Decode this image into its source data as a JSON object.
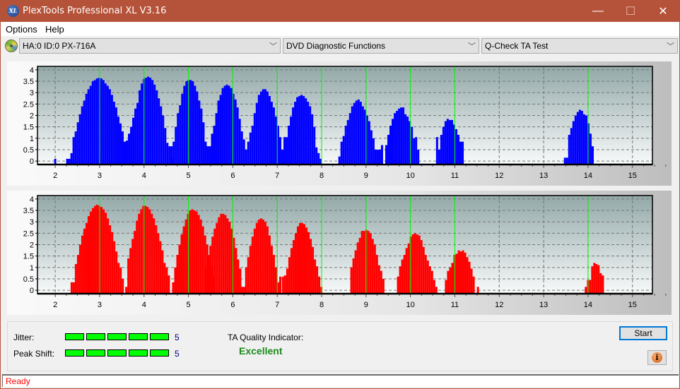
{
  "window": {
    "title": "PlexTools Professional XL V3.16",
    "app_icon_text": "XL",
    "minimize_glyph": "—",
    "maximize_glyph": "☐",
    "close_glyph": "✕"
  },
  "menu": [
    "Options",
    "Help"
  ],
  "toolbar": {
    "drive": "HA:0 ID:0  PX-716A",
    "function_group": "DVD Diagnostic Functions",
    "test": "Q-Check TA Test",
    "chevron": "﹀"
  },
  "colors": {
    "accent_title": "#b5533a",
    "top_bars": "#0000ff",
    "bottom_bars": "#ff0000",
    "marker_lines": "#00ff00",
    "quality_text": "#1a8a1a",
    "status_text": "#ff0000"
  },
  "chart_data": [
    {
      "type": "bar",
      "name": "top-chart",
      "title": "",
      "xlabel": "",
      "ylabel": "",
      "xlim": [
        1.6,
        15.45
      ],
      "ylim": [
        -0.15,
        4.15
      ],
      "xticks": [
        2,
        3,
        4,
        5,
        6,
        7,
        8,
        9,
        10,
        11,
        12,
        13,
        14,
        15
      ],
      "yticks": [
        0,
        0.5,
        1,
        1.5,
        2,
        2.5,
        3,
        3.5,
        4
      ],
      "ytick_labels": [
        "0",
        "0.5",
        "1",
        "1.5",
        "2",
        "2.5",
        "3",
        "3.5",
        "4"
      ],
      "grid": true,
      "reference_lines_x": [
        3,
        4,
        5,
        6,
        7,
        8,
        9,
        10,
        11,
        14
      ],
      "bar_step": 0.048,
      "clusters": [
        {
          "start": 2.0,
          "values": [
            0.1
          ]
        },
        {
          "start": 2.27,
          "values": [
            0.1,
            0.1,
            0.35,
            1.05,
            1.3,
            1.7,
            2.05,
            2.4,
            2.65,
            2.95,
            3.15,
            3.3,
            3.5,
            3.55,
            3.62,
            3.65,
            3.62,
            3.55,
            3.4,
            3.3,
            3.15,
            2.9,
            2.6,
            2.35,
            1.95,
            1.65,
            1.3,
            0.85,
            0.9,
            1.2,
            1.5,
            1.9,
            2.3,
            2.55,
            3.1,
            3.4,
            3.6,
            3.65,
            3.7,
            3.65,
            3.55,
            3.35,
            3.1,
            2.75,
            2.4,
            2.0,
            1.45,
            0.8,
            0.65,
            0.1
          ]
        },
        {
          "start": 4.62,
          "values": [
            0.65,
            0.85,
            1.5,
            2.1,
            2.45,
            2.95,
            3.3,
            3.5,
            3.55,
            3.55,
            3.5,
            3.3,
            3.05,
            2.65,
            2.3,
            1.7,
            0.85,
            0.65,
            0.65,
            1.2,
            1.55,
            2.1,
            2.65,
            2.9,
            3.2,
            3.3,
            3.35,
            3.3,
            3.2,
            2.95,
            2.7,
            2.35,
            1.85,
            1.3,
            0.95,
            0.5,
            0.85,
            1.25,
            1.55,
            2.1,
            2.55,
            2.9,
            3.05,
            3.15,
            3.15,
            3.05,
            2.85,
            2.6,
            2.35,
            1.95,
            1.55,
            1.05,
            0.5,
            1.05,
            1.05,
            1.55,
            1.95,
            2.35,
            2.6,
            2.8,
            2.85,
            2.9,
            2.85,
            2.75,
            2.6,
            2.4,
            2.05,
            1.5,
            0.6,
            0.35,
            0.1
          ]
        },
        {
          "start": 8.4,
          "values": [
            0.2,
            0.85,
            1.1,
            1.55,
            1.8,
            2.1,
            2.4,
            2.55,
            2.65,
            2.7,
            2.6,
            2.4,
            2.25,
            2.0,
            1.75,
            1.35,
            1.0,
            0.5,
            0.5,
            0.5,
            0.7,
            0.0,
            0.7,
            1.15,
            1.55,
            1.85,
            2.1,
            2.2,
            2.3,
            2.35,
            2.35,
            2.05,
            1.95,
            1.75,
            1.5,
            1.0,
            1.05,
            0.5
          ]
        },
        {
          "start": 10.6,
          "values": [
            1.05,
            0.5,
            1.15,
            1.5,
            1.75,
            1.85,
            1.8,
            1.8,
            1.6,
            1.4,
            1.15,
            0.85,
            0.85
          ]
        },
        {
          "start": 13.48,
          "values": [
            0.15,
            0.15,
            1.15,
            1.45,
            1.75,
            2.0,
            2.15,
            2.25,
            2.2,
            2.05,
            2.0,
            1.65,
            1.2,
            0.65
          ]
        }
      ]
    },
    {
      "type": "bar",
      "name": "bottom-chart",
      "title": "",
      "xlabel": "",
      "ylabel": "",
      "xlim": [
        1.6,
        15.45
      ],
      "ylim": [
        -0.15,
        4.15
      ],
      "xticks": [
        2,
        3,
        4,
        5,
        6,
        7,
        8,
        9,
        10,
        11,
        12,
        13,
        14,
        15
      ],
      "yticks": [
        0,
        0.5,
        1,
        1.5,
        2,
        2.5,
        3,
        3.5,
        4
      ],
      "ytick_labels": [
        "0",
        "0.5",
        "1",
        "1.5",
        "2",
        "2.5",
        "3",
        "3.5",
        "4"
      ],
      "grid": true,
      "reference_lines_x": [
        3,
        4,
        5,
        6,
        7,
        8,
        9,
        10,
        11,
        14
      ],
      "bar_step": 0.048,
      "clusters": [
        {
          "start": 2.37,
          "values": [
            0.35,
            0.35,
            1.15,
            1.55,
            2.0,
            2.4,
            2.7,
            2.95,
            3.25,
            3.45,
            3.6,
            3.7,
            3.75,
            3.7,
            3.65,
            3.55,
            3.4,
            3.15,
            2.85,
            2.55,
            2.15,
            1.7,
            1.2,
            1.0,
            0.5
          ]
        },
        {
          "start": 3.6,
          "values": [
            0.15,
            1.4,
            1.85,
            2.25,
            2.6,
            3.05,
            3.35,
            3.55,
            3.7,
            3.7,
            3.65,
            3.55,
            3.35,
            3.15,
            2.85,
            2.5,
            2.15,
            1.75,
            1.2,
            1.0,
            0.65,
            0.0,
            0.35,
            1.0,
            1.55,
            2.0,
            2.45,
            2.8,
            3.1,
            3.35,
            3.5,
            3.55,
            3.5,
            3.45,
            3.3,
            3.1,
            2.8,
            2.4,
            2.0,
            1.45,
            1.05,
            0.6
          ]
        },
        {
          "start": 5.4,
          "values": [
            1.0,
            1.55,
            1.95,
            2.35,
            2.7,
            2.95,
            3.2,
            3.35,
            3.35,
            3.3,
            3.15,
            3.0,
            2.7,
            2.3,
            1.85,
            1.35,
            0.95,
            0.15,
            0.15
          ]
        },
        {
          "start": 6.3,
          "values": [
            1.0,
            1.45,
            1.95,
            2.35,
            2.7,
            2.95,
            3.1,
            3.15,
            3.1,
            3.0,
            2.8,
            2.4,
            1.95,
            1.55,
            1.0,
            0.35,
            0.6
          ]
        },
        {
          "start": 7.13,
          "values": [
            0.6,
            0.65,
            0.95,
            1.45,
            1.85,
            2.2,
            2.5,
            2.8,
            2.95,
            2.95,
            2.9,
            2.75,
            2.55,
            2.25,
            1.9,
            1.35,
            1.05,
            0.6,
            0.15
          ]
        },
        {
          "start": 8.67,
          "values": [
            1.0,
            1.4,
            1.75,
            2.1,
            2.3,
            2.6,
            2.6,
            2.65,
            2.6,
            2.5,
            2.25,
            2.0,
            1.55,
            1.1,
            0.85,
            0.5
          ]
        },
        {
          "start": 9.72,
          "values": [
            0.6,
            1.05,
            1.35,
            1.55,
            1.85,
            2.05,
            2.35,
            2.45,
            2.5,
            2.45,
            2.4,
            2.2,
            1.9,
            1.55,
            1.3,
            1.05,
            0.85,
            0.45,
            0.15
          ]
        },
        {
          "start": 10.8,
          "values": [
            0.45,
            0.85,
            1.0,
            1.2,
            1.55,
            1.6,
            1.75,
            1.7,
            1.75,
            1.65,
            1.45,
            1.25,
            0.95,
            0.6,
            0.0,
            0.15
          ]
        },
        {
          "start": 13.95,
          "values": [
            0.15,
            0.45,
            0.45,
            1.05,
            1.2,
            1.15,
            1.1,
            0.75,
            0.65
          ]
        }
      ]
    }
  ],
  "bottom": {
    "jitter_label": "Jitter:",
    "jitter_value": "5",
    "jitter_level": 5,
    "peak_shift_label": "Peak Shift:",
    "peak_shift_value": "5",
    "peak_shift_level": 5,
    "meter_max": 5,
    "ta_quality_label": "TA Quality Indicator:",
    "ta_quality_value": "Excellent",
    "start_label": "Start",
    "info_glyph": "i"
  },
  "status": {
    "text": "Ready"
  }
}
